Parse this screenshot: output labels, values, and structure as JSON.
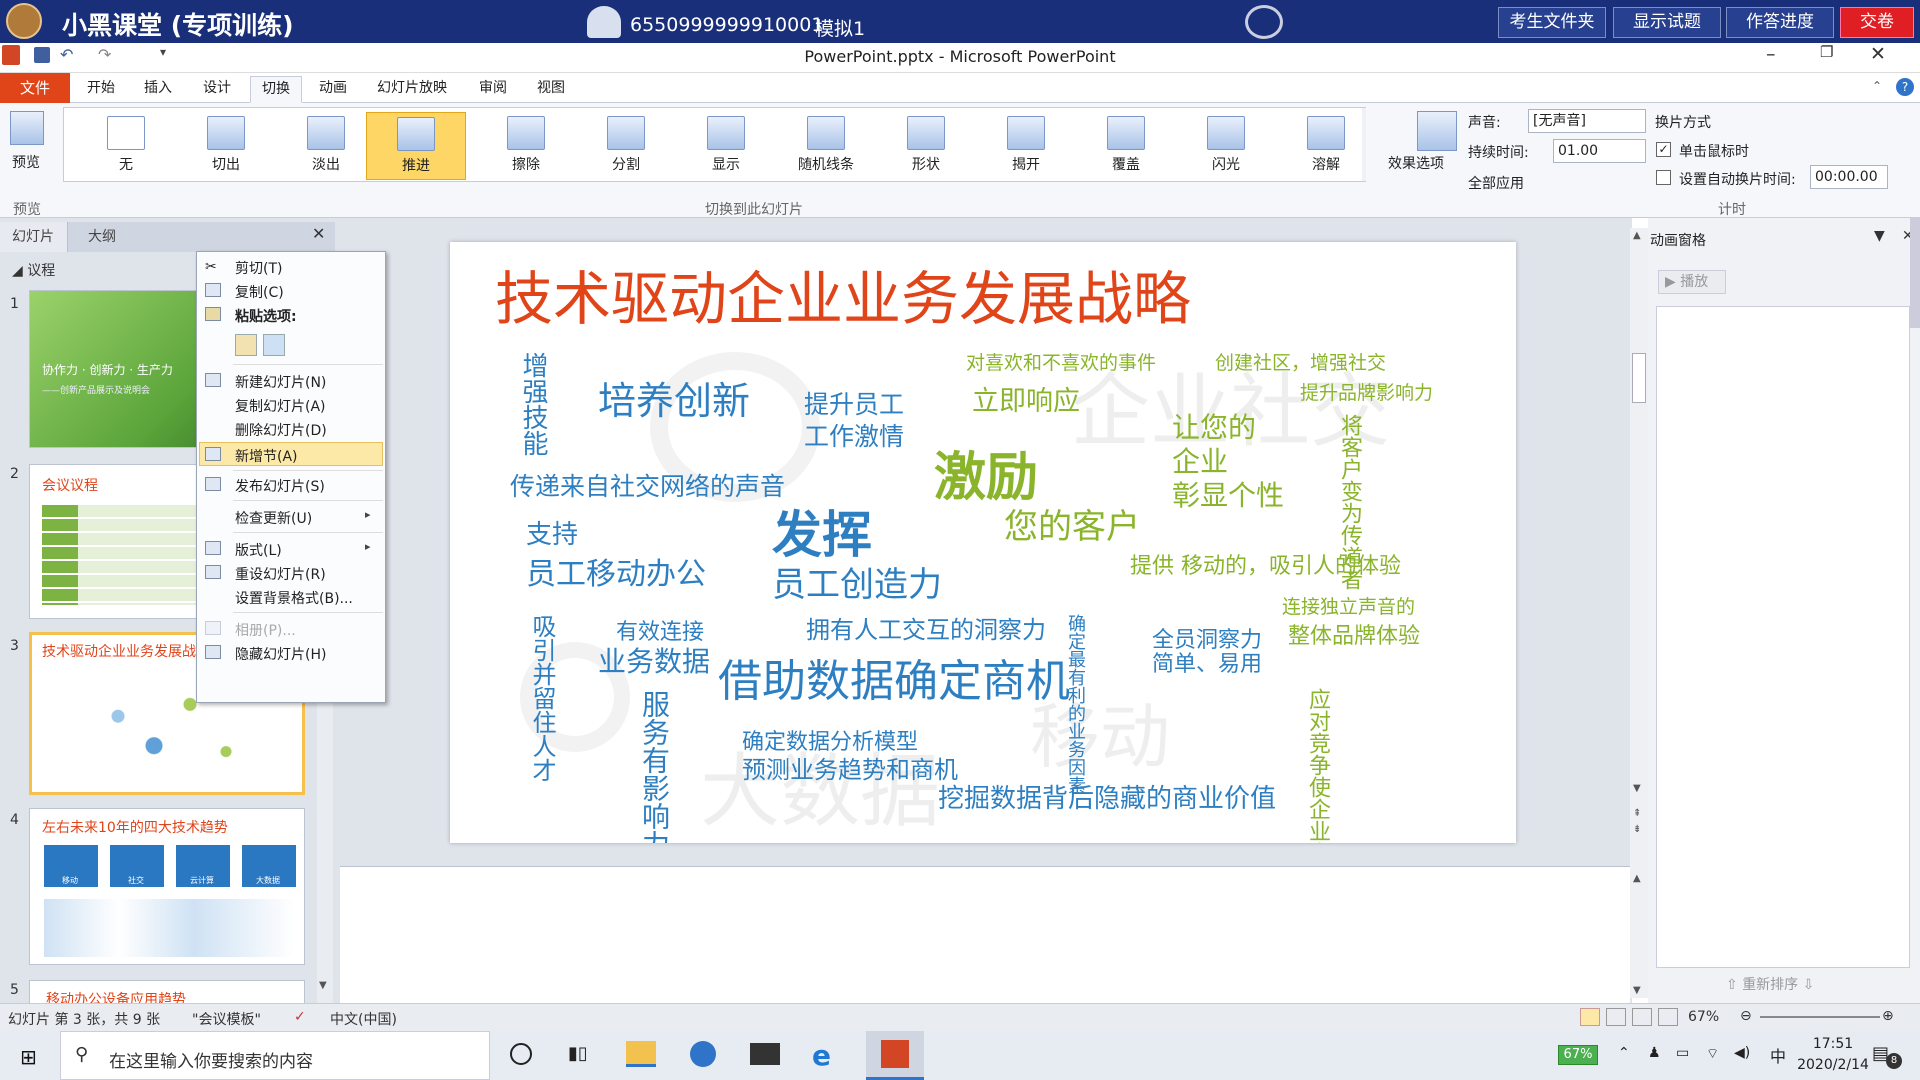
{
  "topbar": {
    "title": "小黑课堂 (专项训练)",
    "user_id": "6550999999910001",
    "mode": "模拟1",
    "buttons": [
      "考生文件夹",
      "显示试题",
      "作答进度",
      "交卷"
    ]
  },
  "window": {
    "doc_title": "PowerPoint.pptx - Microsoft PowerPoint"
  },
  "ribbon_tabs": [
    "文件",
    "开始",
    "插入",
    "设计",
    "切换",
    "动画",
    "幻灯片放映",
    "审阅",
    "视图"
  ],
  "ribbon": {
    "preview_label": "预览",
    "preview_group": "预览",
    "transitions": [
      "无",
      "切出",
      "淡出",
      "推进",
      "擦除",
      "分割",
      "显示",
      "随机线条",
      "形状",
      "揭开",
      "覆盖",
      "闪光",
      "溶解"
    ],
    "selected_transition": "推进",
    "effect_options": "效果选项",
    "group_label": "切换到此幻灯片",
    "sound_label": "声音:",
    "sound_value": "[无声音]",
    "duration_label": "持续时间:",
    "duration_value": "01.00",
    "apply_all": "全部应用",
    "advance_label": "换片方式",
    "on_click": "单击鼠标时",
    "after_label": "设置自动换片时间:",
    "after_value": "00:00.00",
    "timing_group": "计时"
  },
  "left_panel": {
    "tabs": [
      "幻灯片",
      "大纲"
    ],
    "section": "议程",
    "slides": [
      {
        "num": "1",
        "text": "协作力 · 创新力 · 生产力",
        "sub": "——创新产品展示及说明会"
      },
      {
        "num": "2",
        "text": "会议议程"
      },
      {
        "num": "3",
        "text": "技术驱动企业业务发展战略"
      },
      {
        "num": "4",
        "text": "左右未来10年的四大技术趋势",
        "icons": [
          "移动",
          "社交",
          "云计算",
          "大数据"
        ]
      },
      {
        "num": "5",
        "text": "移动办公设备应用趋势"
      }
    ]
  },
  "context_menu": {
    "items": [
      {
        "label": "剪切(T)",
        "enabled": true
      },
      {
        "label": "复制(C)",
        "enabled": true
      },
      {
        "label": "粘贴选项:",
        "enabled": true,
        "bold": true
      },
      {
        "label": "新建幻灯片(N)",
        "enabled": true
      },
      {
        "label": "复制幻灯片(A)",
        "enabled": true
      },
      {
        "label": "删除幻灯片(D)",
        "enabled": true
      },
      {
        "label": "新增节(A)",
        "enabled": true,
        "highlight": true
      },
      {
        "label": "发布幻灯片(S)",
        "enabled": true
      },
      {
        "label": "检查更新(U)",
        "enabled": true,
        "submenu": true
      },
      {
        "label": "版式(L)",
        "enabled": true,
        "submenu": true
      },
      {
        "label": "重设幻灯片(R)",
        "enabled": true
      },
      {
        "label": "设置背景格式(B)...",
        "enabled": true
      },
      {
        "label": "相册(P)...",
        "enabled": false
      },
      {
        "label": "隐藏幻灯片(H)",
        "enabled": true
      }
    ]
  },
  "slide": {
    "title": "技术驱动企业业务发展战略",
    "words": {
      "w1": "培养创新",
      "w2": "提升员工",
      "w3": "工作激情",
      "w4": "对喜欢和不喜欢的事件",
      "w5": "立即响应",
      "w6": "创建社区，增强社交",
      "w7": "提升品牌影响力",
      "w8": "传递来自社交网络的声音",
      "w9": "激励",
      "w10": "让您的",
      "w11": "企业",
      "w12": "彰显个性",
      "w13": "支持",
      "w14": "员工移动办公",
      "w15": "发挥",
      "w16": "员工创造力",
      "w17": "您的客户",
      "w18": "提供 移动的，吸引人的体验",
      "w19": "连接独立声音的",
      "w20": "整体品牌体验",
      "w21": "有效连接",
      "w22": "业务数据",
      "w23": "拥有人工交互的洞察力",
      "w24": "全员洞察力",
      "w25": "简单、易用",
      "w26": "借助数据确定商机",
      "w27": "移动",
      "w28": "确定数据分析模型",
      "w29": "预测业务趋势和商机",
      "w30": "挖掘数据背后隐藏的商业价值",
      "w31": "大数据",
      "w32": "企业社交",
      "v1": "增强技能",
      "v2": "将客户变为传道者",
      "v3": "吸引并留住人才",
      "v4": "服务有影响力的目标客户",
      "v5": "确定最有利的业务因素",
      "v6": "应对竞争使企业变得越来越敏捷"
    }
  },
  "anim_pane": {
    "title": "动画窗格",
    "play": "播放",
    "reorder": "重新排序"
  },
  "statusbar": {
    "slide_info": "幻灯片 第 3 张，共 9 张",
    "theme": "\"会议模板\"",
    "language": "中文(中国)",
    "zoom": "67%"
  },
  "taskbar": {
    "search_placeholder": "在这里输入你要搜索的内容",
    "battery": "67%",
    "time": "17:51",
    "date": "2020/2/14",
    "notif_count": "8",
    "ime": "中"
  }
}
